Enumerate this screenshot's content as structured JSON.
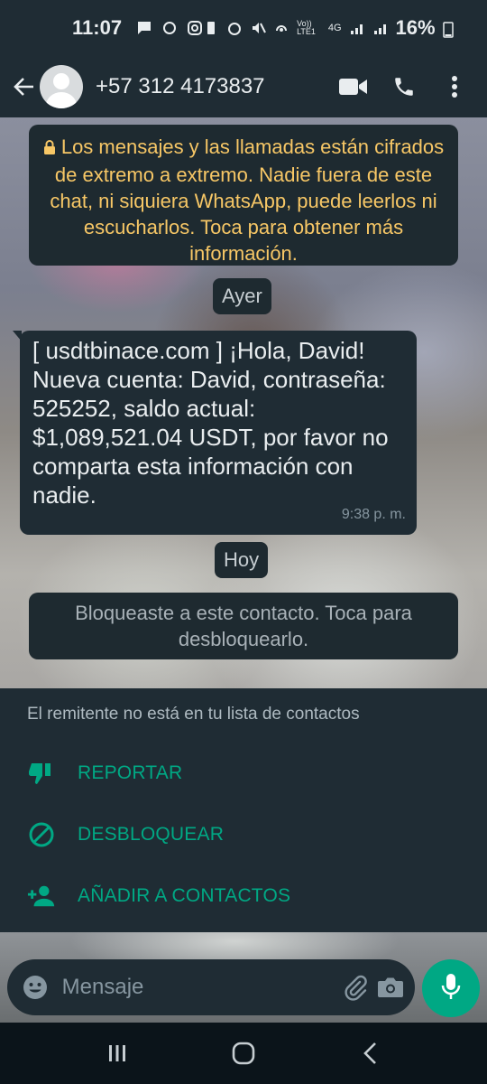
{
  "status_bar": {
    "time": "11:07",
    "battery": "16%",
    "network_labels": [
      "Vo)) LTE1",
      "4G"
    ]
  },
  "header": {
    "contact": "+57 312 4173837",
    "icons": [
      "back-arrow-icon",
      "video-call-icon",
      "voice-call-icon",
      "more-options-icon"
    ]
  },
  "chat": {
    "encryption_notice": "Los mensajes y las llamadas están cifrados de extremo a extremo. Nadie fuera de este chat, ni siquiera WhatsApp, puede leerlos ni escucharlos. Toca para obtener más información.",
    "date_yesterday": "Ayer",
    "message": {
      "text": "[ usdtbinace.com ] ¡Hola, David! Nueva cuenta: David, contraseña: 525252, saldo actual: $1,089,521.04 USDT, por favor no comparta esta información con nadie.",
      "time": "9:38 p. m."
    },
    "date_today": "Hoy",
    "blocked_notice": "Bloqueaste a este contacto. Toca para desbloquearlo."
  },
  "panel": {
    "note": "El remitente no está en tu lista de contactos",
    "actions": [
      {
        "label": "REPORTAR",
        "icon": "thumbs-down-icon"
      },
      {
        "label": "DESBLOQUEAR",
        "icon": "block-icon"
      },
      {
        "label": "AÑADIR A CONTACTOS",
        "icon": "add-person-icon"
      }
    ]
  },
  "composer": {
    "placeholder": "Mensaje",
    "value": ""
  },
  "colors": {
    "accent": "#00a884",
    "bar": "#1f2c34",
    "notice_text": "#f7c766"
  }
}
